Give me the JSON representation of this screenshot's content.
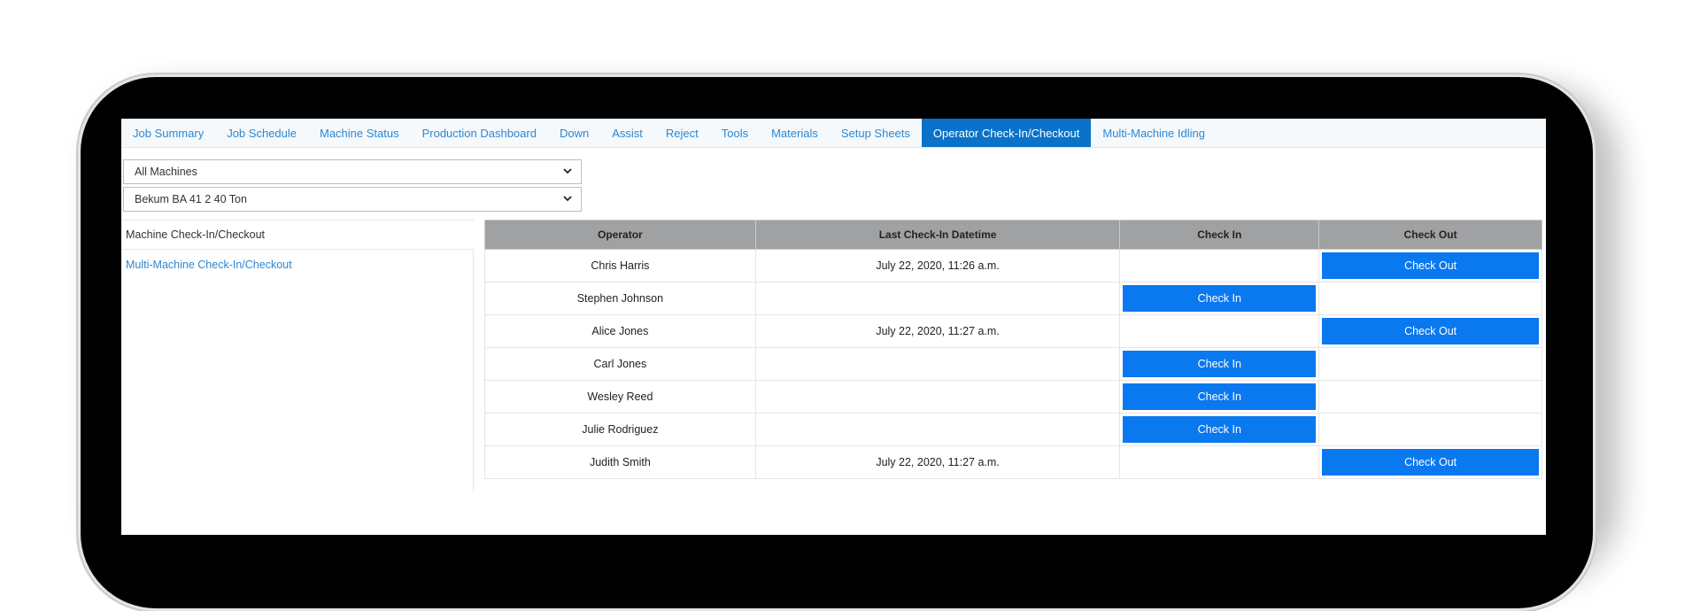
{
  "tabs": [
    {
      "label": "Job Summary",
      "active": false
    },
    {
      "label": "Job Schedule",
      "active": false
    },
    {
      "label": "Machine Status",
      "active": false
    },
    {
      "label": "Production Dashboard",
      "active": false
    },
    {
      "label": "Down",
      "active": false
    },
    {
      "label": "Assist",
      "active": false
    },
    {
      "label": "Reject",
      "active": false
    },
    {
      "label": "Tools",
      "active": false
    },
    {
      "label": "Materials",
      "active": false
    },
    {
      "label": "Setup Sheets",
      "active": false
    },
    {
      "label": "Operator Check-In/Checkout",
      "active": true
    },
    {
      "label": "Multi-Machine Idling",
      "active": false
    }
  ],
  "filters": {
    "machine_group": "All Machines",
    "machine": "Bekum BA 41 2 40 Ton"
  },
  "left_panel": {
    "heading": "Machine Check-In/Checkout",
    "link": "Multi-Machine Check-In/Checkout"
  },
  "table": {
    "headers": {
      "operator": "Operator",
      "last_checkin": "Last Check-In Datetime",
      "check_in": "Check In",
      "check_out": "Check Out"
    },
    "rows": [
      {
        "operator": "Chris Harris",
        "last_checkin": "July 22, 2020, 11:26 a.m.",
        "action": "Check Out"
      },
      {
        "operator": "Stephen Johnson",
        "last_checkin": "",
        "action": "Check In"
      },
      {
        "operator": "Alice Jones",
        "last_checkin": "July 22, 2020, 11:27 a.m.",
        "action": "Check Out"
      },
      {
        "operator": "Carl Jones",
        "last_checkin": "",
        "action": "Check In"
      },
      {
        "operator": "Wesley Reed",
        "last_checkin": "",
        "action": "Check In"
      },
      {
        "operator": "Julie Rodriguez",
        "last_checkin": "",
        "action": "Check In"
      },
      {
        "operator": "Judith Smith",
        "last_checkin": "July 22, 2020, 11:27 a.m.",
        "action": "Check Out"
      }
    ]
  },
  "colors": {
    "accent": "#0a73c9",
    "button": "#0a78ef",
    "link": "#2b87d1",
    "table_header": "#a0a1a3"
  }
}
